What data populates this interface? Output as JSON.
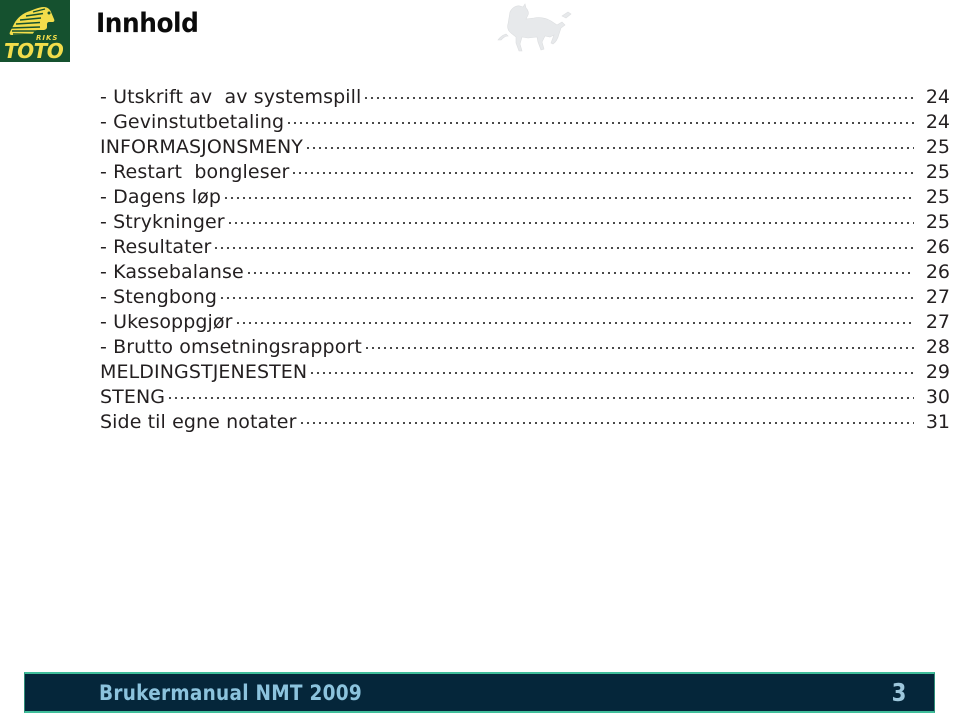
{
  "header": {
    "title": "Innhold",
    "logo": {
      "name": "rikstoto-logo",
      "primary_text": "TOTO",
      "secondary_text": "RIKS",
      "bg_color": "#15512f",
      "fg_color": "#f2dd4b"
    },
    "watermark": {
      "name": "galloping-horse-watermark",
      "color": "#e8eaec"
    }
  },
  "toc": {
    "entries": [
      {
        "label": "- Utskrift av  av systemspill",
        "page": "24"
      },
      {
        "label": "- Gevinstutbetaling",
        "page": "24"
      },
      {
        "label": "INFORMASJONSMENY",
        "page": "25"
      },
      {
        "label": "- Restart  bongleser",
        "page": "25"
      },
      {
        "label": "- Dagens løp",
        "page": "25"
      },
      {
        "label": "- Strykninger",
        "page": "25"
      },
      {
        "label": "- Resultater",
        "page": "26"
      },
      {
        "label": "- Kassebalanse",
        "page": "26"
      },
      {
        "label": "- Stengbong",
        "page": "27"
      },
      {
        "label": "- Ukesoppgjør",
        "page": "27"
      },
      {
        "label": "- Brutto omsetningsrapport",
        "page": "28"
      },
      {
        "label": "MELDINGSTJENESTEN",
        "page": "29"
      },
      {
        "label": "STENG",
        "page": "30"
      },
      {
        "label": "Side til egne notater",
        "page": "31"
      }
    ]
  },
  "footer": {
    "title": "Brukermanual NMT 2009",
    "page_number": "3",
    "bar_color": "#05263a",
    "accent_color": "#3fbd9a",
    "text_color": "#8cc3dd"
  }
}
